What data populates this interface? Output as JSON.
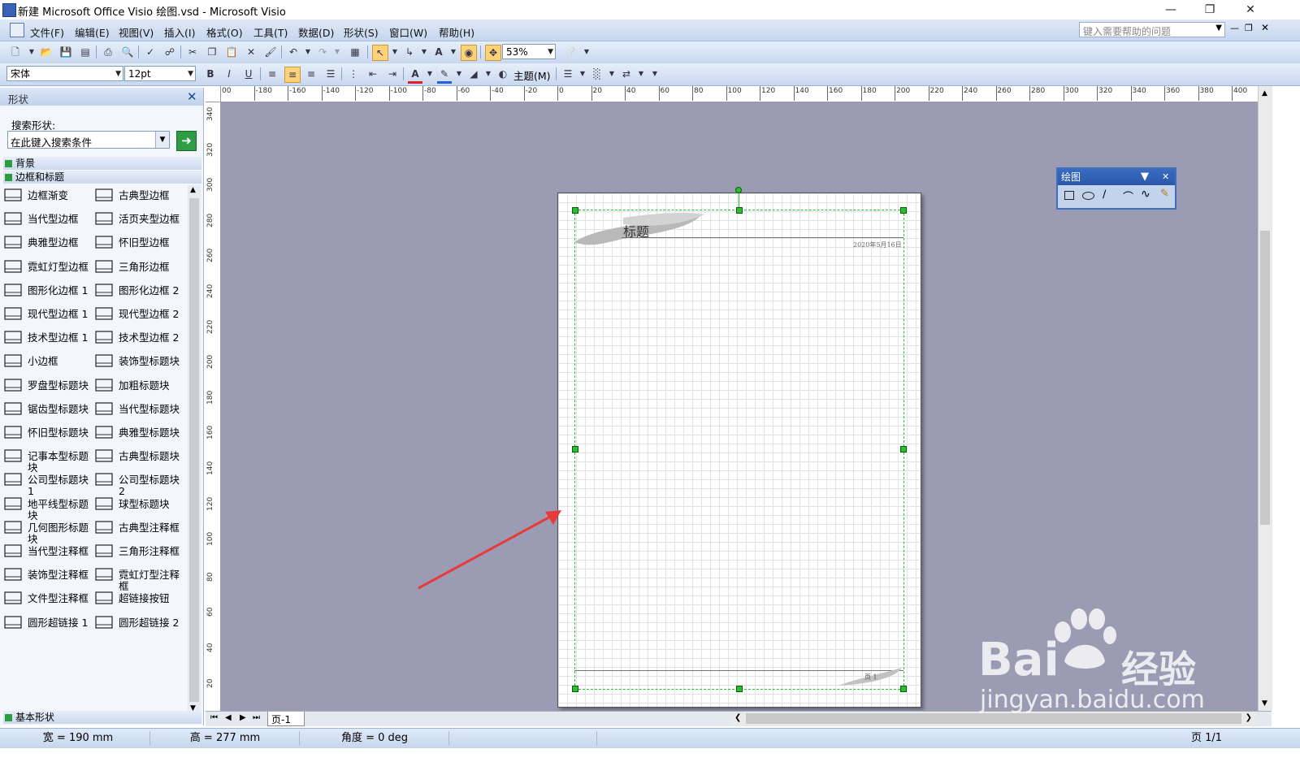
{
  "window": {
    "title": "新建 Microsoft Office Visio 绘图.vsd - Microsoft Visio"
  },
  "menu": {
    "items": [
      "文件(F)",
      "编辑(E)",
      "视图(V)",
      "插入(I)",
      "格式(O)",
      "工具(T)",
      "数据(D)",
      "形状(S)",
      "窗口(W)",
      "帮助(H)"
    ],
    "help_placeholder": "键入需要帮助的问题"
  },
  "toolbar": {
    "zoom": "53%",
    "font": "宋体",
    "font_size": "12pt",
    "theme_label": "主题(M)",
    "bold": "B",
    "italic": "I",
    "underline": "U"
  },
  "shapes_pane": {
    "title": "形状",
    "search_label": "搜索形状:",
    "search_placeholder": "在此键入搜索条件",
    "stencils": [
      "背景",
      "边框和标题"
    ],
    "bottom_stencil": "基本形状",
    "items_left": [
      "边框渐变",
      "当代型边框",
      "典雅型边框",
      "霓虹灯型边框",
      "图形化边框 1",
      "现代型边框 1",
      "技术型边框 1",
      "小边框",
      "罗盘型标题块",
      "锯齿型标题块",
      "怀旧型标题块",
      "记事本型标题块",
      "公司型标题块 1",
      "地平线型标题块",
      "几何图形标题块",
      "当代型注释框",
      "装饰型注释框",
      "文件型注释框",
      "圆形超链接 1"
    ],
    "items_right": [
      "古典型边框",
      "活页夹型边框",
      "怀旧型边框",
      "三角形边框",
      "图形化边框 2",
      "现代型边框 2",
      "技术型边框 2",
      "装饰型标题块",
      "加粗标题块",
      "当代型标题块",
      "典雅型标题块",
      "古典型标题块",
      "公司型标题块 2",
      "球型标题块",
      "古典型注释框",
      "三角形注释框",
      "霓虹灯型注释框",
      "超链接按钮",
      "圆形超链接 2"
    ]
  },
  "rulers": {
    "horizontal": [
      "00",
      "-180",
      "-160",
      "-140",
      "-120",
      "-100",
      "-80",
      "-60",
      "-40",
      "-20",
      "0",
      "20",
      "40",
      "60",
      "80",
      "100",
      "120",
      "140",
      "160",
      "180",
      "200",
      "220",
      "240",
      "260",
      "280",
      "300",
      "320",
      "340",
      "360",
      "380",
      "400"
    ],
    "vertical": [
      "340",
      "320",
      "300",
      "280",
      "260",
      "240",
      "220",
      "200",
      "180",
      "160",
      "140",
      "120",
      "100",
      "80",
      "60",
      "40",
      "20"
    ]
  },
  "page": {
    "title_text": "标题",
    "date_text": "2020年5月16日",
    "footer_text": "页 1"
  },
  "drawing_toolbar": {
    "title": "绘图"
  },
  "tabs": {
    "page_tab": "页-1"
  },
  "status": {
    "width": "宽 = 190 mm",
    "height": "高 = 277 mm",
    "angle": "角度 = 0 deg",
    "page": "页 1/1"
  },
  "watermark": {
    "brand": "Bai",
    "brand_cn": "经验",
    "url": "jingyan.baidu.com"
  },
  "colors": {
    "canvas": "#9b9cb4",
    "handle": "#29c030",
    "arrow": "#e83a3a",
    "accent": "#3e6fb8"
  }
}
